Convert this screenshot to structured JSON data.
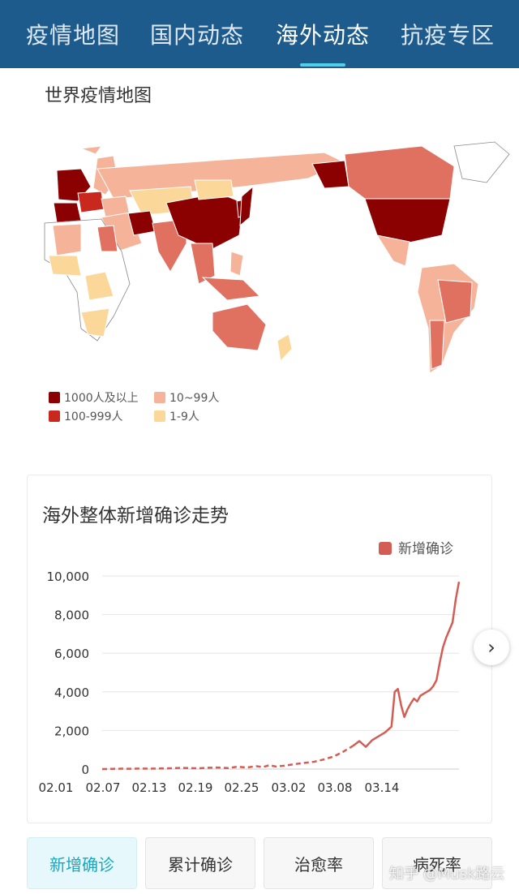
{
  "tabs": [
    {
      "label": "疫情地图"
    },
    {
      "label": "国内动态"
    },
    {
      "label": "海外动态",
      "active": true
    },
    {
      "label": "抗疫专区"
    }
  ],
  "map": {
    "title": "世界疫情地图",
    "legend": [
      {
        "label": "1000人及以上",
        "color": "#8b0000"
      },
      {
        "label": "10~99人",
        "color": "#f5b49a"
      },
      {
        "label": "100-999人",
        "color": "#c9281f"
      },
      {
        "label": "1-9人",
        "color": "#fbd79a"
      }
    ]
  },
  "trend": {
    "title": "海外整体新增确诊走势",
    "chart_data": {
      "type": "line",
      "series": [
        {
          "name": "新增确诊",
          "color": "#d35d55"
        }
      ],
      "x_tick_labels": [
        "02.01",
        "02.07",
        "02.13",
        "02.19",
        "02.25",
        "03.02",
        "03.08",
        "03.14"
      ],
      "y_tick_labels": [
        "10,000",
        "8,000",
        "6,000",
        "4,000",
        "2,000",
        "0"
      ],
      "ylim": [
        0,
        10000
      ],
      "points": [
        [
          0,
          0
        ],
        [
          3,
          10
        ],
        [
          6,
          20
        ],
        [
          9,
          15
        ],
        [
          12,
          30
        ],
        [
          15,
          20
        ],
        [
          18,
          30
        ],
        [
          21,
          40
        ],
        [
          24,
          60
        ],
        [
          27,
          50
        ],
        [
          30,
          40
        ],
        [
          33,
          70
        ],
        [
          36,
          80
        ],
        [
          39,
          50
        ],
        [
          42,
          120
        ],
        [
          45,
          80
        ],
        [
          48,
          150
        ],
        [
          50,
          100
        ],
        [
          52,
          200
        ],
        [
          54,
          130
        ],
        [
          57,
          180
        ],
        [
          60,
          260
        ],
        [
          63,
          320
        ],
        [
          66,
          380
        ],
        [
          69,
          500
        ],
        [
          72,
          650
        ],
        [
          75,
          900
        ],
        [
          78,
          1200
        ],
        [
          80,
          1450
        ],
        [
          82,
          1150
        ],
        [
          84,
          1500
        ],
        [
          86,
          1700
        ],
        [
          88,
          1900
        ],
        [
          90,
          2200
        ],
        [
          91,
          4000
        ],
        [
          92,
          4150
        ],
        [
          93,
          3300
        ],
        [
          94,
          2700
        ],
        [
          95,
          3100
        ],
        [
          96,
          3400
        ],
        [
          97,
          3650
        ],
        [
          98,
          3500
        ],
        [
          99,
          3800
        ],
        [
          100,
          3900
        ],
        [
          101,
          4000
        ],
        [
          102,
          4100
        ],
        [
          103,
          4300
        ],
        [
          104,
          4600
        ],
        [
          105,
          5500
        ],
        [
          106,
          6300
        ],
        [
          107,
          6800
        ],
        [
          108,
          7200
        ],
        [
          109,
          7600
        ],
        [
          110,
          8800
        ],
        [
          111,
          9700
        ]
      ]
    }
  },
  "bottom_buttons": [
    {
      "label": "新增确诊",
      "active": true
    },
    {
      "label": "累计确诊"
    },
    {
      "label": "治愈率"
    },
    {
      "label": "病死率"
    }
  ],
  "icons": {
    "next": "chevron-right-icon"
  },
  "watermark": "知乎 @Musk路云"
}
